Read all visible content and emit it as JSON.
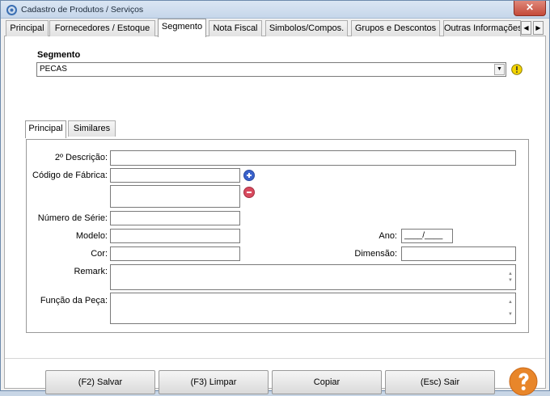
{
  "window": {
    "title": "Cadastro de Produtos / Serviços",
    "close_label": "✕"
  },
  "main_tabs": [
    {
      "label": "Principal"
    },
    {
      "label": "Fornecedores / Estoque"
    },
    {
      "label": "Segmento"
    },
    {
      "label": "Nota Fiscal"
    },
    {
      "label": "Simbolos/Compos."
    },
    {
      "label": "Grupos e Descontos"
    },
    {
      "label": "Outras Informações"
    }
  ],
  "active_tab": "Segmento",
  "tab_scroll": {
    "left": "◀",
    "right": "▶"
  },
  "segmento": {
    "label": "Segmento",
    "value": "PECAS",
    "dropdown_arrow": "▼"
  },
  "inner_tabs": [
    {
      "label": "Principal"
    },
    {
      "label": "Similares"
    }
  ],
  "form": {
    "descricao2": {
      "label": "2º Descrição:",
      "value": ""
    },
    "codigo_fabrica": {
      "label": "Código de Fábrica:",
      "value": "",
      "list_value": ""
    },
    "numero_serie": {
      "label": "Número de Série:",
      "value": ""
    },
    "modelo": {
      "label": "Modelo:",
      "value": ""
    },
    "ano": {
      "label": "Ano:",
      "value": "____/____"
    },
    "cor": {
      "label": "Cor:",
      "value": ""
    },
    "dimensao": {
      "label": "Dimensão:",
      "value": ""
    },
    "remark": {
      "label": "Remark:",
      "value": ""
    },
    "funcao_peca": {
      "label": "Função da Peça:",
      "value": ""
    }
  },
  "buttons": {
    "salvar": "(F2) Salvar",
    "limpar": "(F3) Limpar",
    "copiar": "Copiar",
    "sair": "(Esc) Sair"
  },
  "colors": {
    "help": "#e8862a",
    "warn": "#f4d400",
    "add": "#3a62cc",
    "remove": "#d84a5e"
  }
}
